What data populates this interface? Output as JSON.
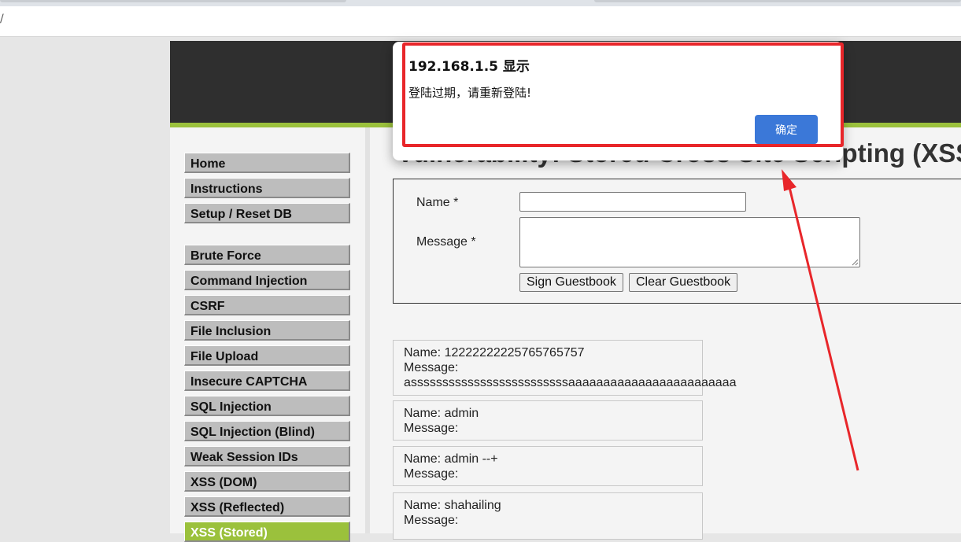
{
  "browser": {
    "address_text": "/"
  },
  "colors": {
    "header_bg": "#2f2f2f",
    "accent_green": "#9bc13c",
    "menu_item_bg": "#bdbdbd",
    "dialog_button": "#3b78d8",
    "annotation_red": "#e8262a"
  },
  "sidebar": {
    "groups": [
      [
        "Home",
        "Instructions",
        "Setup / Reset DB"
      ],
      [
        "Brute Force",
        "Command Injection",
        "CSRF",
        "File Inclusion",
        "File Upload",
        "Insecure CAPTCHA",
        "SQL Injection",
        "SQL Injection (Blind)",
        "Weak Session IDs",
        "XSS (DOM)",
        "XSS (Reflected)",
        "XSS (Stored)"
      ]
    ],
    "active": "XSS (Stored)"
  },
  "main": {
    "title": "Vulnerability: Stored Cross Site Scripting (XSS)",
    "form": {
      "name_label": "Name *",
      "message_label": "Message *",
      "name_value": "",
      "message_value": "",
      "sign_button": "Sign Guestbook",
      "clear_button": "Clear Guestbook"
    },
    "entries": [
      {
        "name": "Name: 12222222225765765757",
        "message": "Message:",
        "message_body": "asssssssssssssssssssssssssaaaaaaaaaaaaaaaaaaaaaaaa"
      },
      {
        "name": "Name: admin",
        "message": "Message:",
        "message_body": ""
      },
      {
        "name": "Name: admin --+",
        "message": "Message:",
        "message_body": ""
      },
      {
        "name": "Name: shahailing",
        "message": "Message:",
        "message_body": ""
      }
    ]
  },
  "dialog": {
    "title": "192.168.1.5 显示",
    "message": "登陆过期，请重新登陆!",
    "ok_label": "确定"
  }
}
